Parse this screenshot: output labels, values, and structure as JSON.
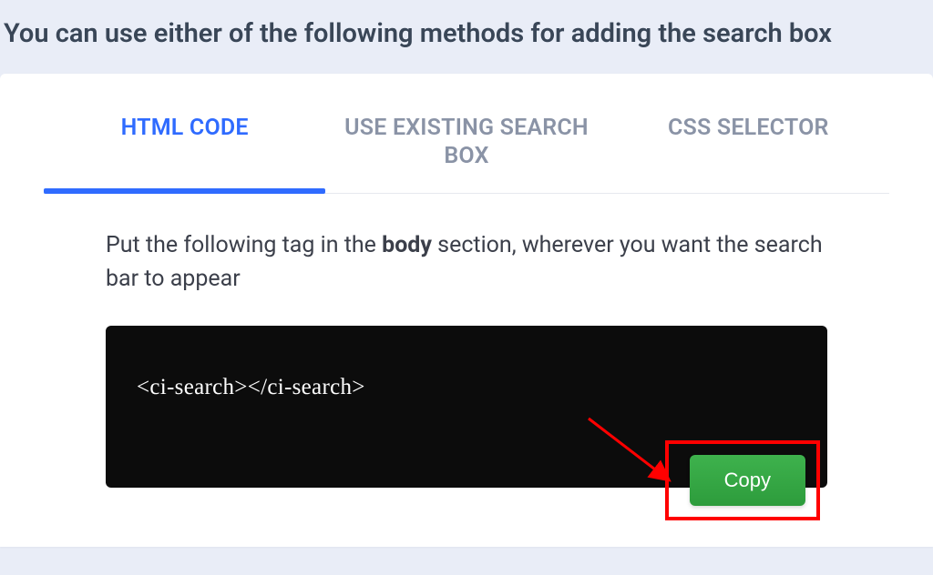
{
  "header": {
    "title": "You can use either of the following methods for adding the search box"
  },
  "tabs": [
    {
      "label": "HTML CODE",
      "active": true
    },
    {
      "label": "USE EXISTING SEARCH BOX",
      "active": false
    },
    {
      "label": "CSS SELECTOR",
      "active": false
    }
  ],
  "instruction": {
    "pre": "Put the following tag in the ",
    "bold": "body",
    "post": " section, wherever you want the search bar to appear"
  },
  "code": {
    "snippet": "<ci-search></ci-search>",
    "copy_label": "Copy"
  }
}
